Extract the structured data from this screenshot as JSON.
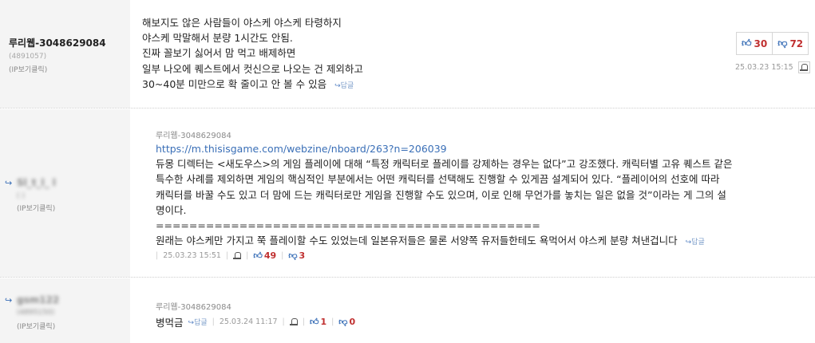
{
  "comments": [
    {
      "nick": "루리웹-3048629084",
      "uid": "(4891057)",
      "ip_label": "(IP보기클릭)",
      "lines": [
        "해보지도 않은 사람들이 야스케 야스케 타령하지",
        "야스케 막말해서 분량 1시간도 안됨.",
        "진짜 꼴보기 싫어서 맘 먹고 배제하면",
        "일부 나오에 퀘스트에서 컷신으로 나오는 건 제외하고",
        "30~40분 미만으로 확 줄이고 안 볼 수 있음"
      ],
      "reply_label": "답글",
      "upvotes": "30",
      "downvotes": "72",
      "date": "25.03.23 15:15"
    },
    {
      "nick": "Sl_t_l_ l",
      "uid": "(   )",
      "ip_label": "(IP보기클릭)",
      "quote_author": "루리웹-3048629084",
      "url": "https://m.thisisgame.com/webzine/nboard/263?n=206039",
      "lines": [
        "듀몽 디렉터는 <새도우스>의 게임 플레이에 대해 “특정 캐릭터로 플레이를 강제하는 경우는 없다”고 강조했다. 캐릭터별 고유 퀘스트 같은",
        "특수한 사례를 제외하면 게임의 핵심적인 부분에서는 어떤 캐릭터를 선택해도 진행할 수 있게끔 설계되어 있다. “플레이어의 선호에 따라",
        "캐릭터를 바꿀 수도 있고 더 맘에 드는 캐릭터로만 게임을 진행할 수도 있으며, 이로 인해 무언가를 놓치는 일은 없을 것”이라는 게 그의 설",
        "명이다."
      ],
      "separator": "==============================================",
      "last_line": "원래는 야스케만 가지고 쭉 플레이할 수도 있었는데 일본유저들은 물론 서양쪽 유저들한테도 욕먹어서 야스케 분량 쳐낸겁니다",
      "reply_label": "답글",
      "date": "25.03.23 15:51",
      "upvotes": "49",
      "downvotes": "3"
    },
    {
      "nick": "gsm122",
      "uid": "(4895150)",
      "ip_label": "(IP보기클릭)",
      "quote_author": "루리웹-3048629084",
      "text": "병먹금",
      "reply_label": "답글",
      "date": "25.03.24 11:17",
      "upvotes": "1",
      "downvotes": "0"
    }
  ],
  "icons": {
    "reply": "reply-arrow-icon",
    "thumb_up": "thumbs-up-icon",
    "thumb_down": "thumbs-down-icon",
    "report": "report-bell-icon"
  },
  "colors": {
    "upvote": "#3a6fb7",
    "downvote": "#c03030",
    "link": "#3a6fb7"
  }
}
